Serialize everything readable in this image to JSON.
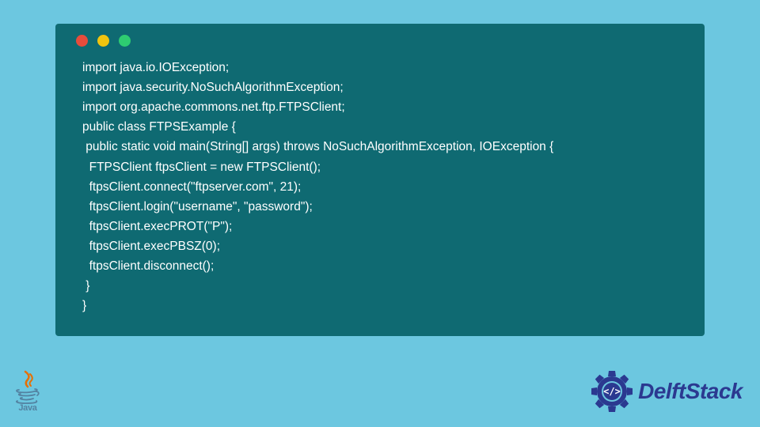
{
  "code": {
    "lines": [
      "import java.io.IOException;",
      "import java.security.NoSuchAlgorithmException;",
      "import org.apache.commons.net.ftp.FTPSClient;",
      "public class FTPSExample {",
      " public static void main(String[] args) throws NoSuchAlgorithmException, IOException {",
      "  FTPSClient ftpsClient = new FTPSClient();",
      "  ftpsClient.connect(\"ftpserver.com\", 21);",
      "  ftpsClient.login(\"username\", \"password\");",
      "  ftpsClient.execPROT(\"P\");",
      "  ftpsClient.execPBSZ(0);",
      "  ftpsClient.disconnect();",
      " }",
      "}"
    ]
  },
  "footer": {
    "java_label": "Java",
    "brand_label": "DelftStack"
  },
  "colors": {
    "page_bg": "#6cc7e0",
    "window_bg": "#0f6a72",
    "code_text": "#ffffff",
    "java_red": "#e76f00",
    "java_blue": "#5382a1",
    "delft_blue": "#2b3990"
  }
}
